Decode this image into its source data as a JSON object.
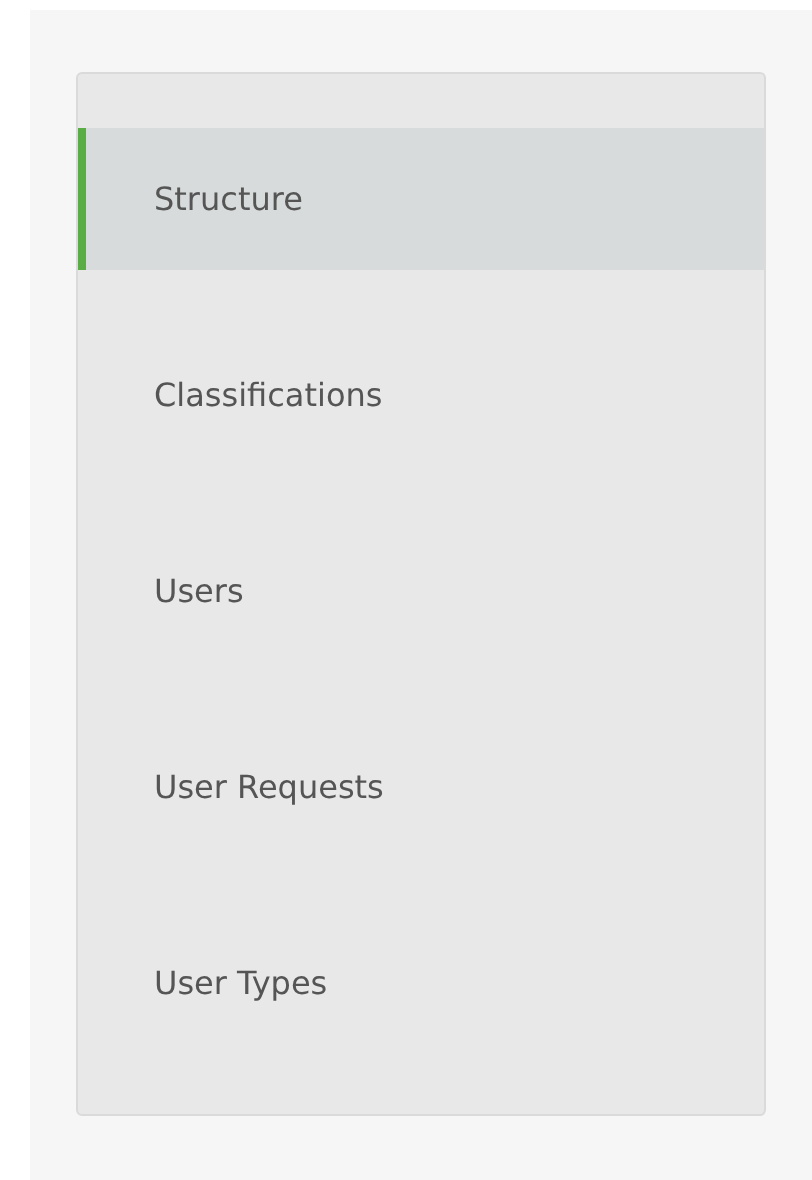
{
  "menu": {
    "items": [
      {
        "label": "Structure",
        "selected": true
      },
      {
        "label": "Classifications",
        "selected": false
      },
      {
        "label": "Users",
        "selected": false
      },
      {
        "label": "User Requests",
        "selected": false
      },
      {
        "label": "User Types",
        "selected": false
      }
    ]
  }
}
